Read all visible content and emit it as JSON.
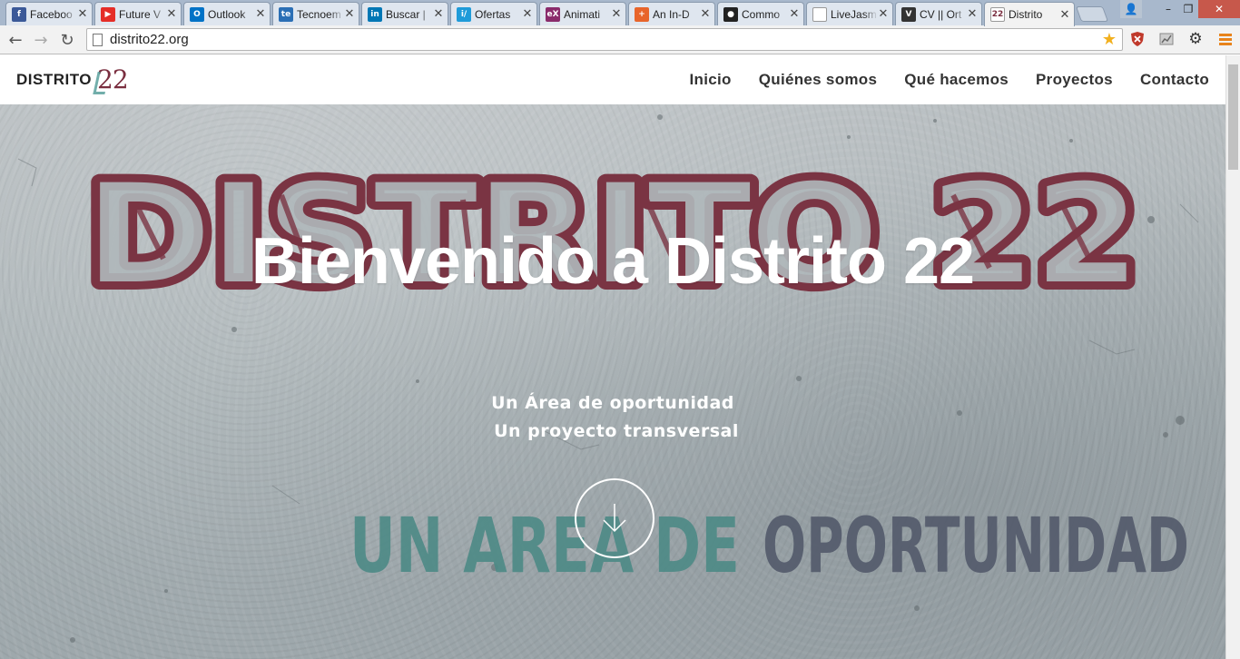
{
  "browser": {
    "tabs": [
      {
        "title": "Faceboo",
        "icon": "facebook-icon",
        "color": "#3b5998",
        "glyph": "f"
      },
      {
        "title": "Future V",
        "icon": "youtube-icon",
        "color": "#e52d27",
        "glyph": "▶"
      },
      {
        "title": "Outlook",
        "icon": "outlook-icon",
        "color": "#0072c6",
        "glyph": "O"
      },
      {
        "title": "Tecnoem",
        "icon": "tecnoempleo-icon",
        "color": "#2b6fb5",
        "glyph": "te"
      },
      {
        "title": "Buscar |",
        "icon": "linkedin-icon",
        "color": "#0077b5",
        "glyph": "in"
      },
      {
        "title": "Ofertas",
        "icon": "infojobs-icon",
        "color": "#1f9bd9",
        "glyph": "i/"
      },
      {
        "title": "Animati",
        "icon": "edx-icon",
        "color": "#8a2b6b",
        "glyph": "eX"
      },
      {
        "title": "An In-D",
        "icon": "plus-icon",
        "color": "#e8652b",
        "glyph": "+"
      },
      {
        "title": "Commo",
        "icon": "github-icon",
        "color": "#222222",
        "glyph": "●"
      },
      {
        "title": "LiveJasm",
        "icon": "page-icon",
        "color": "#ffffff",
        "glyph": ""
      },
      {
        "title": "CV || Ort",
        "icon": "vr-icon",
        "color": "#333333",
        "glyph": "V"
      },
      {
        "title": "Distrito",
        "icon": "distrito22-icon",
        "color": "#ffffff",
        "glyph": "22",
        "active": true
      }
    ],
    "url": "distrito22.org",
    "window_controls": {
      "minimize": "–",
      "maximize": "❐",
      "close": "✕"
    }
  },
  "site": {
    "brand_text": "DISTRITO",
    "brand_number": "22",
    "nav": [
      "Inicio",
      "Quiénes somos",
      "Qué hacemos",
      "Proyectos",
      "Contacto"
    ],
    "hero": {
      "title": "Bienvenido a Distrito 22",
      "subtitle_1": "Un Área de oportunidad",
      "subtitle_2": "Un proyecto transversal",
      "graffiti_top": "DISTRITO 22",
      "graffiti_bottom_1": "UN AREA DE",
      "graffiti_bottom_2": "OPORTUNIDAD"
    },
    "colors": {
      "graffiti_maroon": "#7a3443",
      "graffiti_teal": "#4d8a86",
      "graffiti_slate": "#535a6b",
      "wall": "#a9b2b5"
    }
  }
}
